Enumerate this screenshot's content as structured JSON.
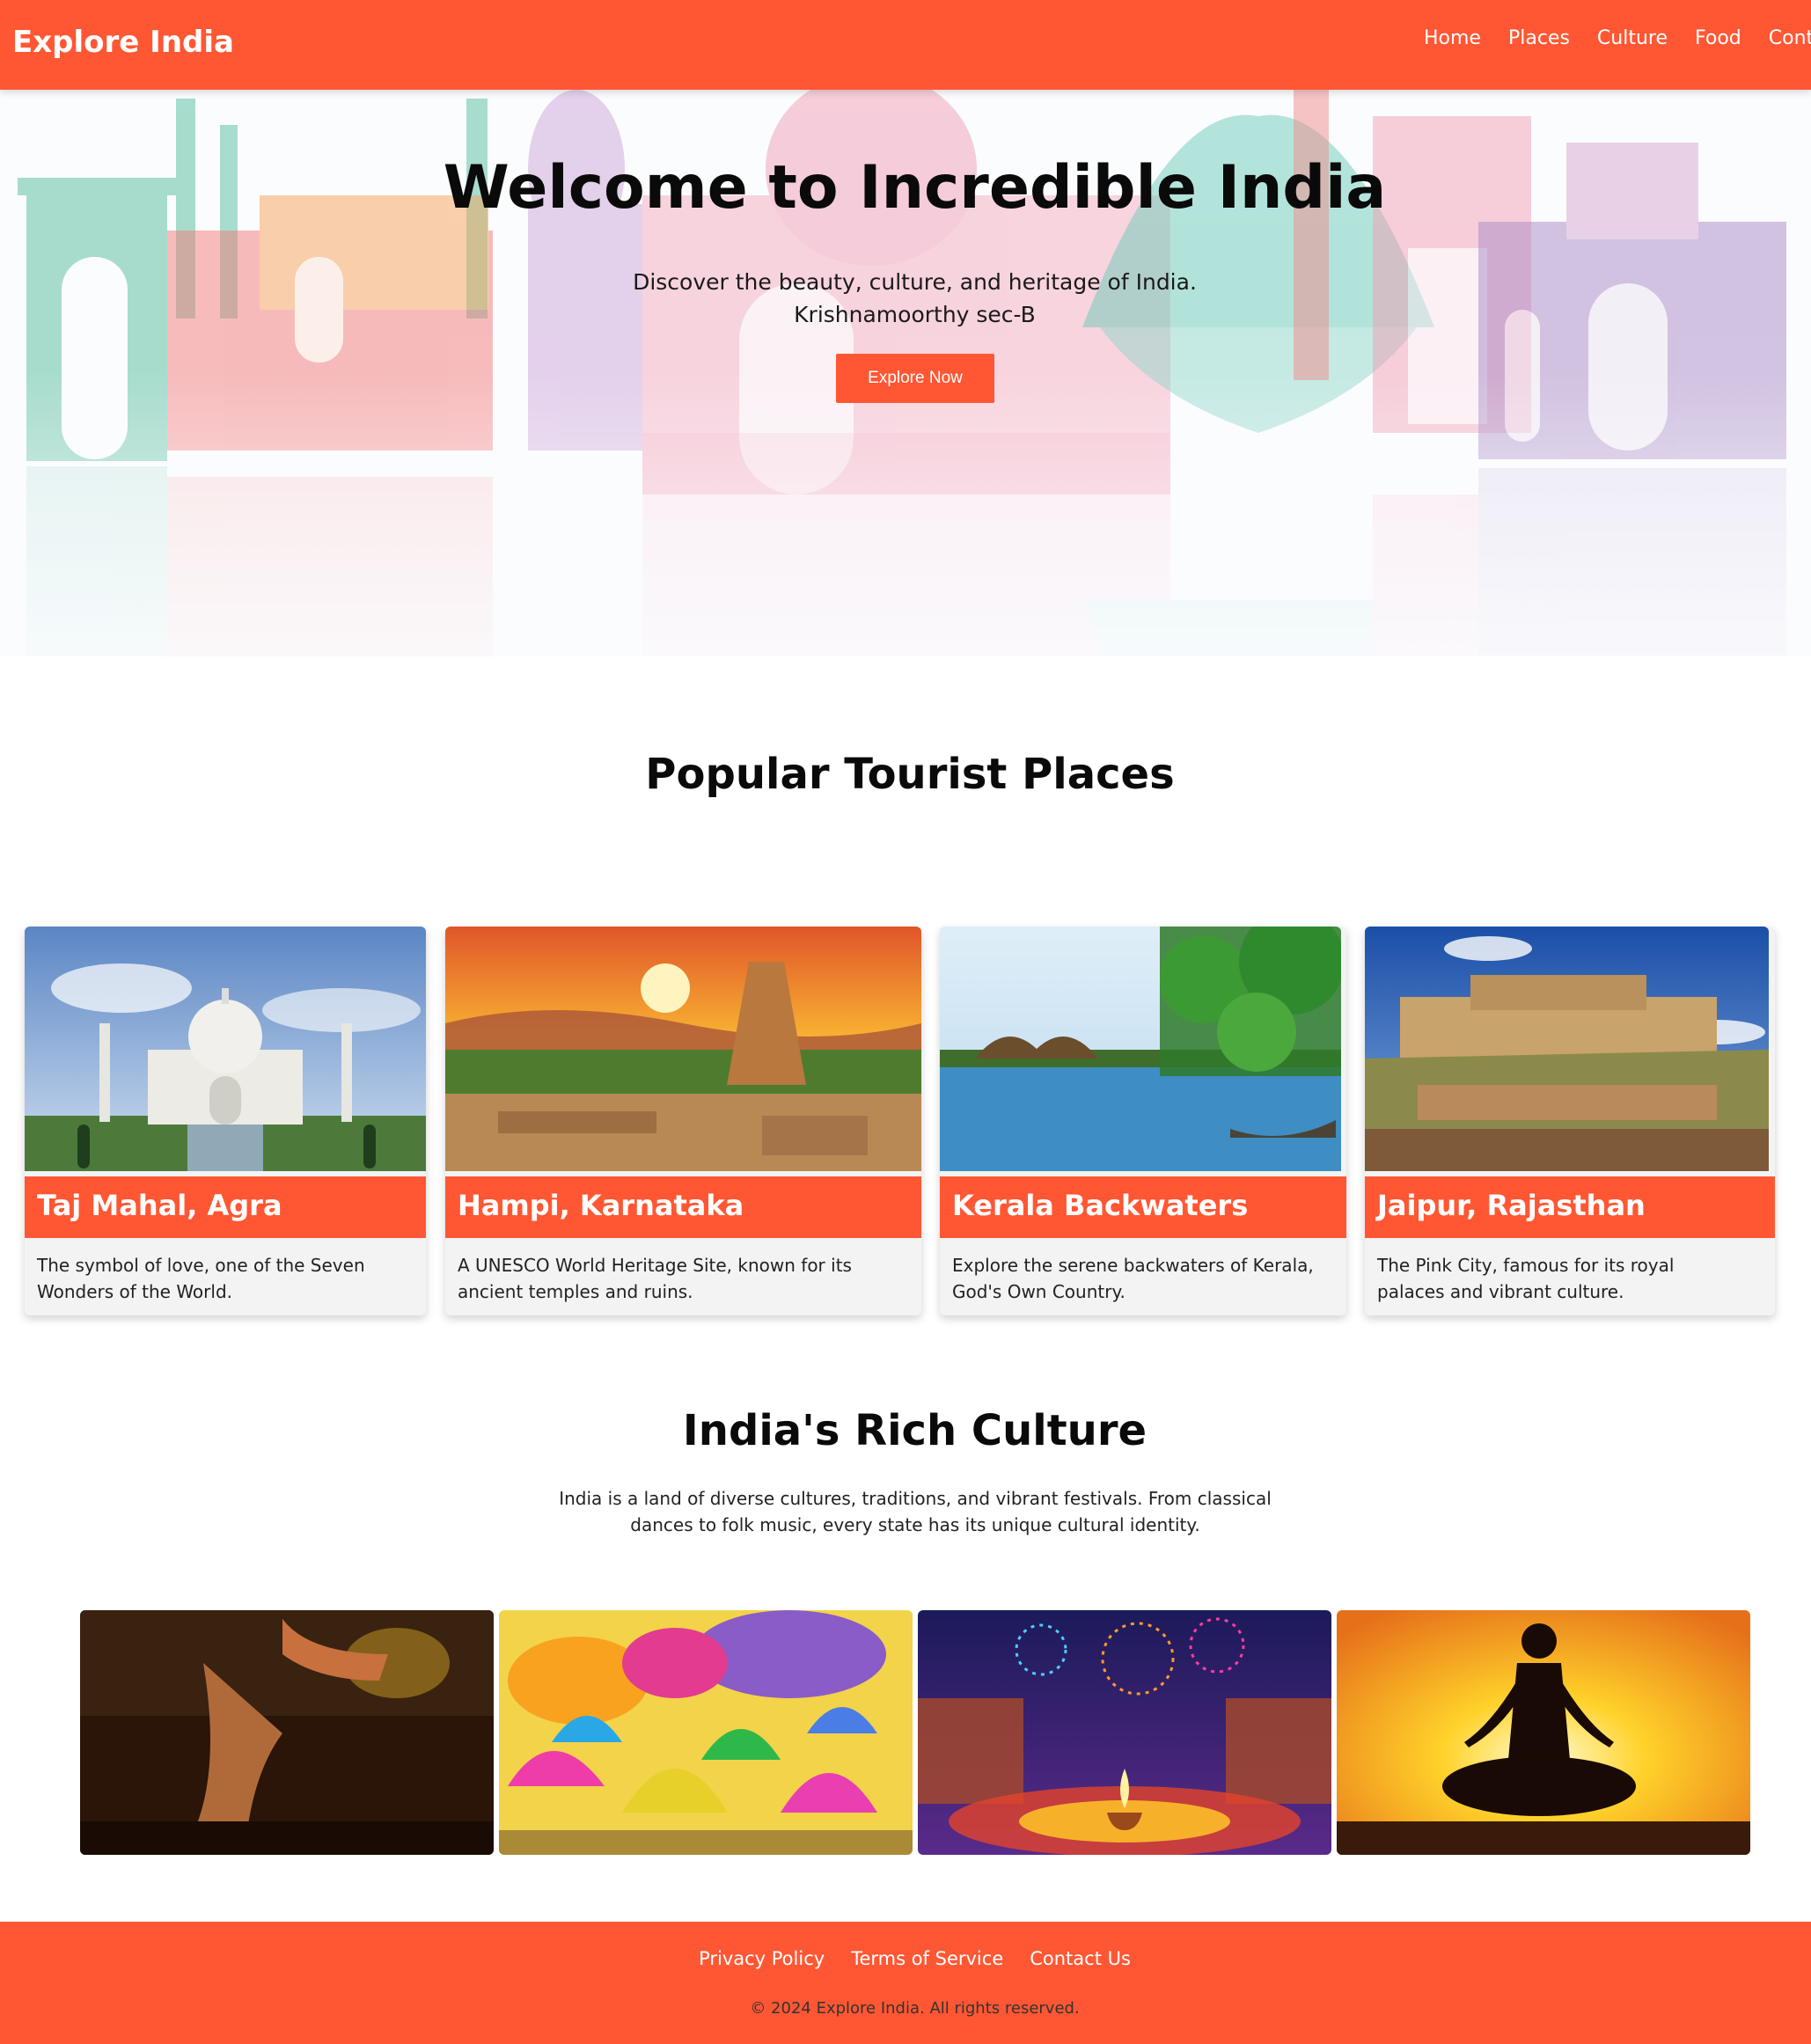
{
  "brand": "Explore India",
  "nav": [
    "Home",
    "Places",
    "Culture",
    "Food",
    "Contact"
  ],
  "hero": {
    "title": "Welcome to Incredible India",
    "subtitle_line1": "Discover the beauty, culture, and heritage of India.",
    "subtitle_line2": "Krishnamoorthy sec-B",
    "button": "Explore Now"
  },
  "places": {
    "heading": "Popular Tourist Places",
    "cards": [
      {
        "title": "Taj Mahal, Agra",
        "desc": "The symbol of love, one of the Seven Wonders of the World."
      },
      {
        "title": "Hampi, Karnataka",
        "desc": "A UNESCO World Heritage Site, known for its ancient temples and ruins."
      },
      {
        "title": "Kerala Backwaters",
        "desc": "Explore the serene backwaters of Kerala, God's Own Country."
      },
      {
        "title": "Jaipur, Rajasthan",
        "desc": "The Pink City, famous for its royal palaces and vibrant culture."
      }
    ]
  },
  "culture": {
    "heading": "India's Rich Culture",
    "desc": "India is a land of diverse cultures, traditions, and vibrant festivals. From classical dances to folk music, every state has its unique cultural identity."
  },
  "footer": {
    "links": [
      "Privacy Policy",
      "Terms of Service",
      "Contact Us"
    ],
    "copyright": "© 2024 Explore India. All rights reserved."
  },
  "colors": {
    "accent": "#ff5733",
    "card_bg": "#f3f3f3"
  }
}
